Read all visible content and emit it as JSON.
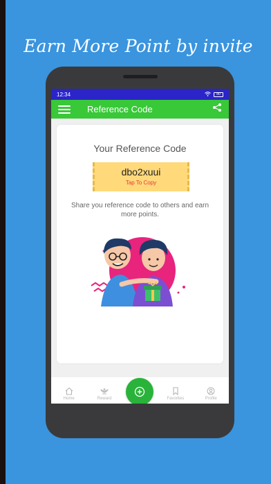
{
  "banner": {
    "title": "Earn More Point by invite"
  },
  "status_bar": {
    "time": "12:34",
    "battery": "80"
  },
  "app_bar": {
    "title": "Reference Code"
  },
  "card": {
    "title": "Your Reference Code",
    "code": "dbo2xuui",
    "tap_to_copy": "Tap To Copy",
    "description": "Share you reference code to others and earn more points."
  },
  "bottom_nav": {
    "items": [
      {
        "label": "Home",
        "icon": "home-icon"
      },
      {
        "label": "Reward",
        "icon": "reward-icon"
      },
      {
        "label": "Favorites",
        "icon": "bookmark-icon"
      },
      {
        "label": "Profile",
        "icon": "profile-icon"
      }
    ],
    "fab_icon": "plus-icon"
  },
  "colors": {
    "background": "#3a94de",
    "status_bar": "#2a24c9",
    "app_bar": "#38c838",
    "ticket": "#ffd97a",
    "fab": "#2ab33a"
  }
}
